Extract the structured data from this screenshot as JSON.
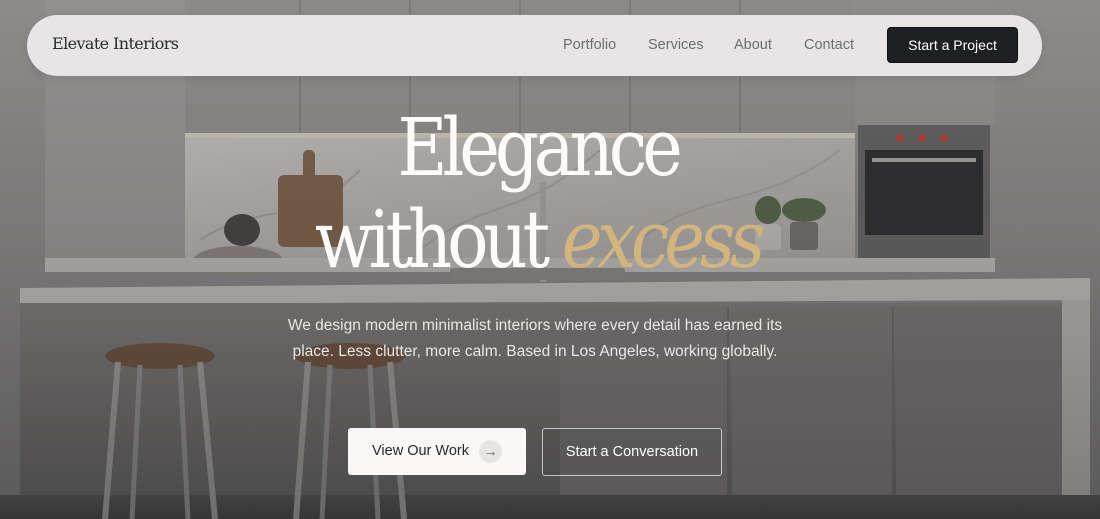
{
  "nav": {
    "logo": "Elevate Interiors",
    "links": [
      "Portfolio",
      "Services",
      "About",
      "Contact"
    ],
    "cta": "Start a Project"
  },
  "hero": {
    "headline_line1": "Elegance",
    "headline_line2_prefix": "without",
    "headline_line2_accent": "excess",
    "subtext": "We design modern minimalist interiors where every detail has earned its place. Less clutter, more calm. Based in Los Angeles, working globally.",
    "primary_button": "View Our Work",
    "primary_button_icon": "arrow-right-icon",
    "secondary_button": "Start a Conversation"
  },
  "colors": {
    "accent": "#d2b47c",
    "nav_background": "#ecebeb",
    "cta_background": "#1f2024"
  }
}
